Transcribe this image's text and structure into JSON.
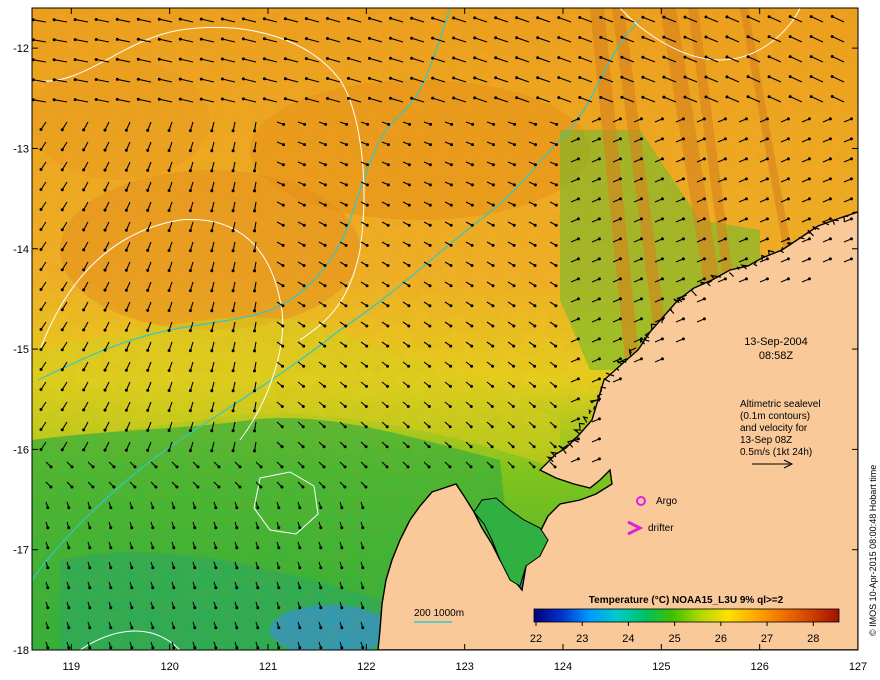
{
  "map": {
    "lat_ticks": [
      {
        "label": "-12",
        "value": -12
      },
      {
        "label": "-13",
        "value": -13
      },
      {
        "label": "-14",
        "value": -14
      },
      {
        "label": "-15",
        "value": -15
      },
      {
        "label": "-16",
        "value": -16
      },
      {
        "label": "-17",
        "value": -17
      },
      {
        "label": "-18",
        "value": -18
      }
    ],
    "lon_ticks": [
      {
        "label": "119",
        "value": 119
      },
      {
        "label": "120",
        "value": 120
      },
      {
        "label": "121",
        "value": 121
      },
      {
        "label": "122",
        "value": 122
      },
      {
        "label": "123",
        "value": 123
      },
      {
        "label": "124",
        "value": 124
      },
      {
        "label": "125",
        "value": 125
      },
      {
        "label": "126",
        "value": 126
      },
      {
        "label": "127",
        "value": 127
      }
    ],
    "lon_range": [
      118.6,
      127
    ],
    "lat_range": [
      -18,
      -11.6
    ]
  },
  "annotations": {
    "date": "13-Sep-2004",
    "time": "08:58Z",
    "altimetry_line1": "Altimetric sealevel",
    "altimetry_line2": "(0.1m contours)",
    "altimetry_line3": "and velocity for",
    "altimetry_line4": "13-Sep 08Z",
    "altimetry_line5": "0.5m/s (1kt 24h)",
    "argo_label": "Argo",
    "drifter_label": "drifter",
    "bathy_label": "200  1000m",
    "credit": "© IMOS 10-Apr-2015 08:00:48 Hobart time"
  },
  "colorbar": {
    "title": "Temperature (°C) NOAA15_L3U 9% ql>=2",
    "ticks": [
      "22",
      "23",
      "24",
      "25",
      "26",
      "27",
      "28"
    ],
    "range": [
      22,
      28.6
    ],
    "colors": {
      "stops": [
        "#00007a",
        "#0033cc",
        "#0099ff",
        "#00cccc",
        "#00c060",
        "#40c000",
        "#b0d800",
        "#ffe000",
        "#ffa800",
        "#f07000",
        "#d04000",
        "#a01000"
      ]
    }
  },
  "colors": {
    "land": "#f9c99a",
    "bathy": "#30c8c8",
    "sealevel_contour": "#ffffff",
    "argo_marker": "#e020e0",
    "drifter_marker": "#e020e0",
    "coast": "#000000"
  }
}
